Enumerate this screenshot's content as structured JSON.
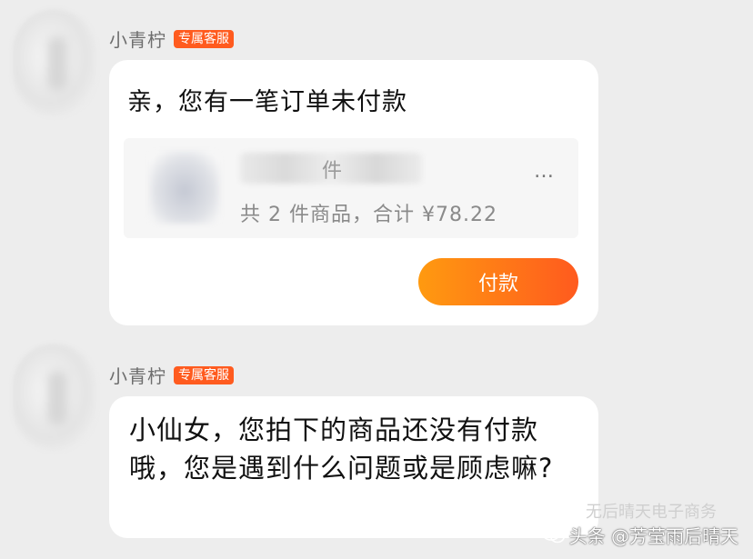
{
  "messages": [
    {
      "sender": "小青柠",
      "badge": "专属客服",
      "card": {
        "title": "亲，您有一笔订单未付款",
        "product_name": "件",
        "product_suffix": "…",
        "summary": "共 2 件商品，合计 ¥78.22",
        "button": "付款"
      }
    },
    {
      "sender": "小青柠",
      "badge": "专属客服",
      "text": "小仙女，您拍下的商品还没有付款哦，您是遇到什么问题或是顾虑嘛?"
    }
  ],
  "watermark": {
    "line1": "无后晴天电子商务",
    "line2": "头条 @芳莹雨后晴天",
    "icon": "wechat-icon"
  },
  "colors": {
    "accent": "#ff5b1f",
    "button_start": "#ff9a10",
    "button_end": "#ff5a1e"
  }
}
